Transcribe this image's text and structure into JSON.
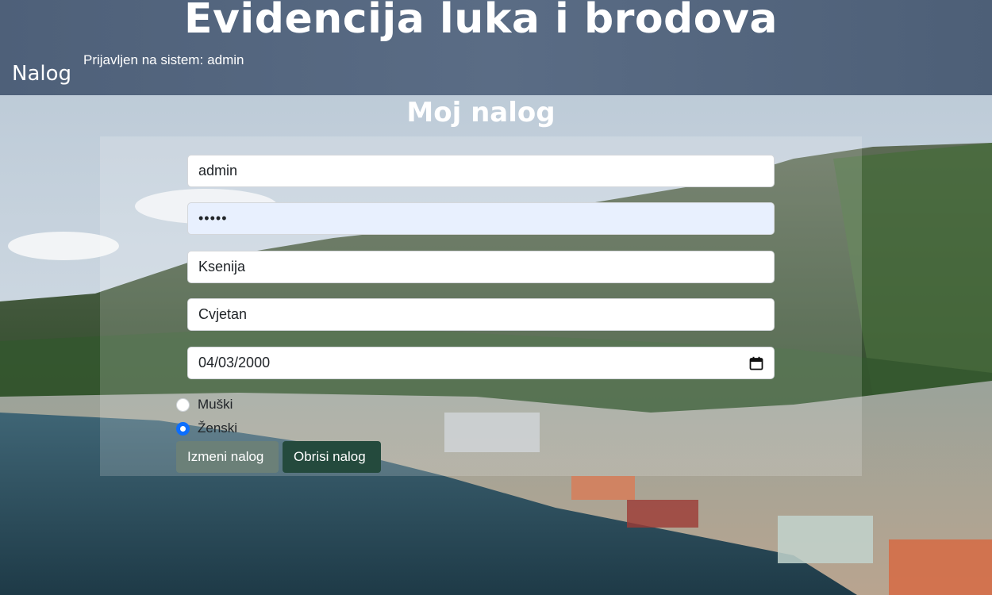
{
  "header": {
    "title": "Evidencija luka i brodova",
    "nav_account": "Nalog",
    "logged_in_label": "Prijavljen na sistem:",
    "logged_in_user": "admin"
  },
  "page": {
    "title": "Moj nalog"
  },
  "form": {
    "username": "admin",
    "password_mask": "•••••",
    "first_name": "Ksenija",
    "last_name": "Cvjetan",
    "birth_date": "04/03/2000",
    "gender_options": [
      "Muški",
      "Ženski"
    ],
    "gender_selected": "Ženski",
    "edit_label": "Izmeni nalog",
    "delete_label": "Obrisi nalog"
  },
  "colors": {
    "header": "#566880",
    "radio_accent": "#0d6efd",
    "edit_button": "#6b8078",
    "delete_button": "#244a3d",
    "autofill_field": "#e8f0fe"
  },
  "icons": {
    "date_picker": "calendar-icon"
  }
}
